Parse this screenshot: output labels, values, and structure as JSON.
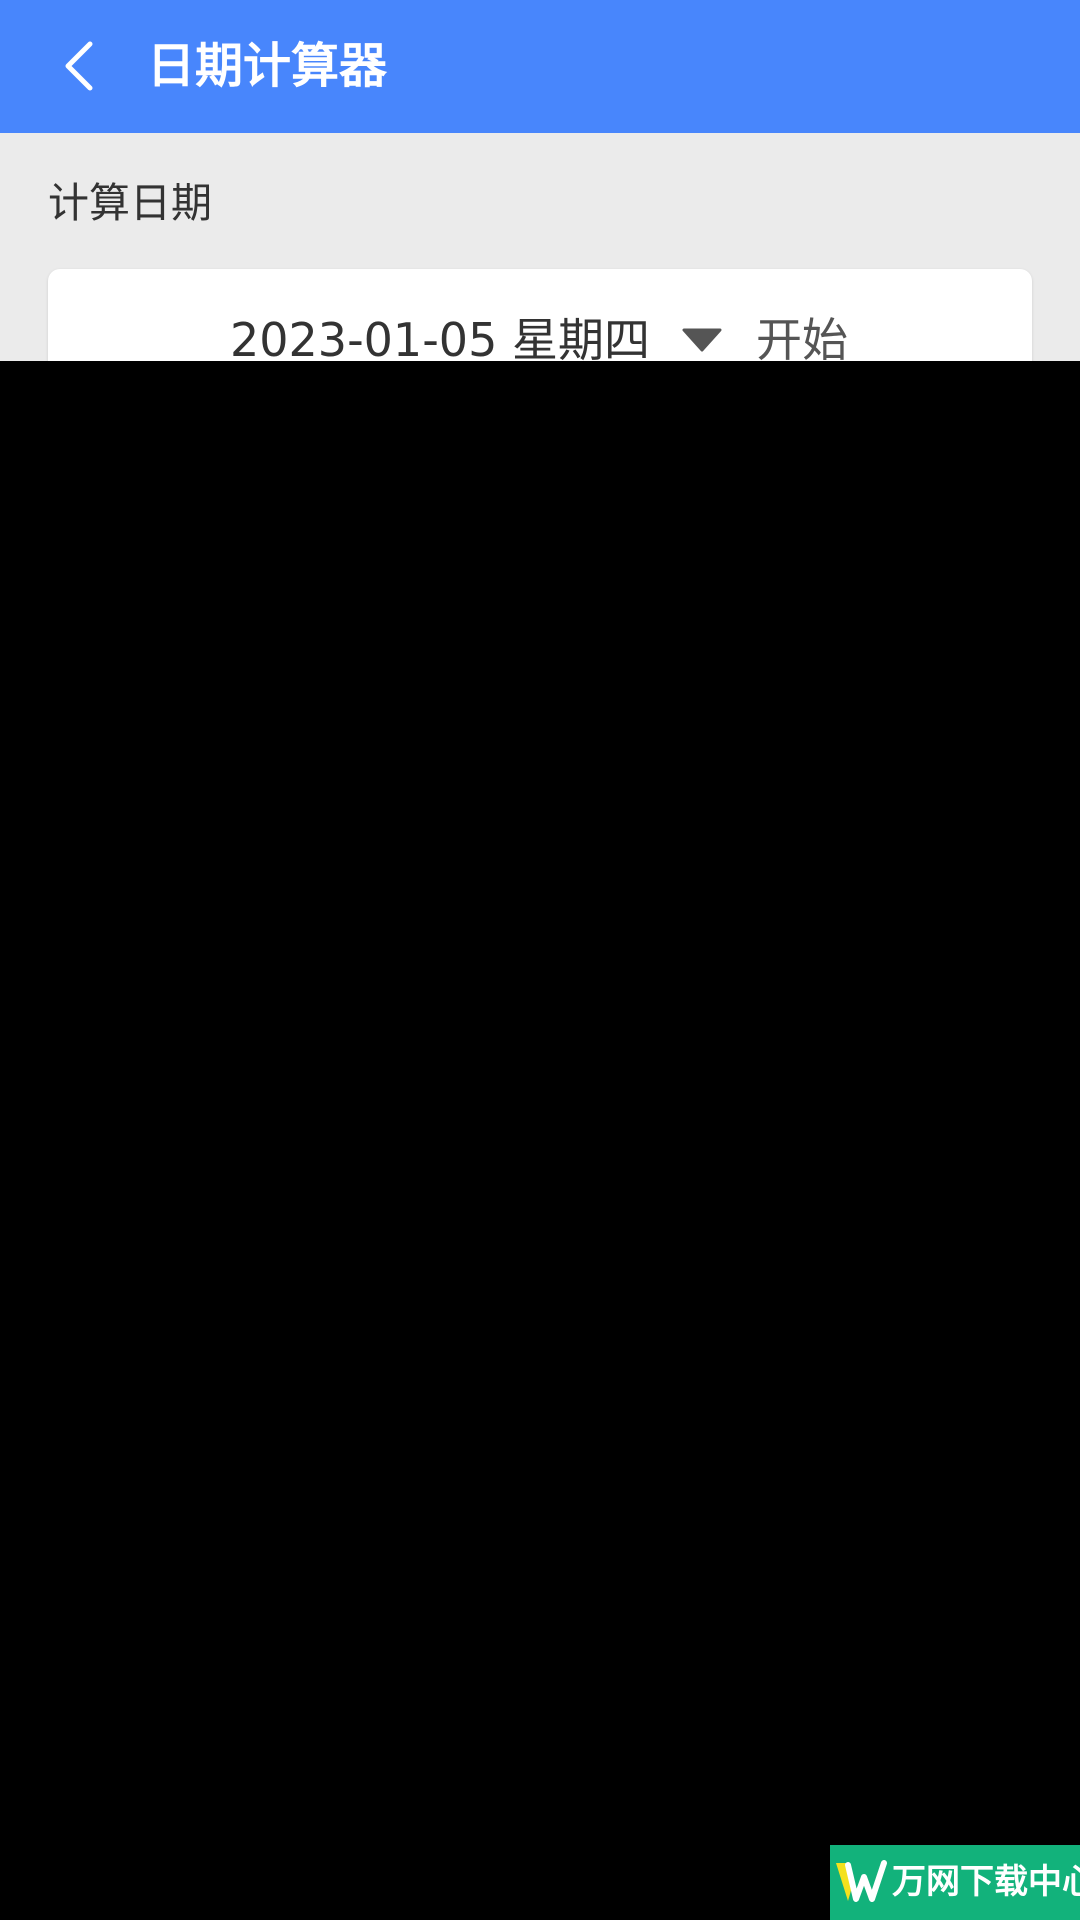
{
  "header": {
    "title": "日期计算器",
    "back_icon": "chevron-left-icon",
    "background_color": "#4886fc"
  },
  "main": {
    "section_label": "计算日期",
    "date_card": {
      "date_value": "2023-01-05 星期四",
      "dropdown_icon": "caret-down-icon",
      "start_label": "开始"
    }
  },
  "watermark": {
    "text": "万网下载中心",
    "logo_icon": "w-logo-icon",
    "background_color": "#12b27b"
  }
}
